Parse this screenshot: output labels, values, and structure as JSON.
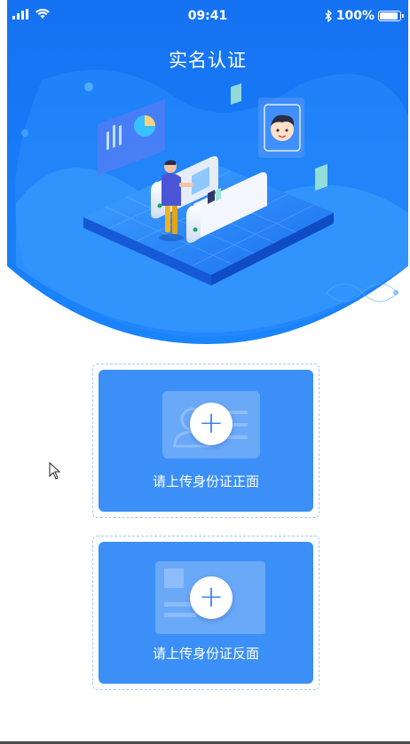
{
  "status_bar": {
    "time": "09:41",
    "battery": "100%",
    "battery_level": 1.0
  },
  "header": {
    "title": "实名认证"
  },
  "uploads": {
    "front_label": "请上传身份证正面",
    "back_label": "请上传身份证反面"
  },
  "colors": {
    "hero_blue": "#1a6ef0",
    "card_blue": "#3b8ff7",
    "card_border": "#a9c6ee"
  },
  "icons": {
    "signal": "signal-icon",
    "wifi": "wifi-icon",
    "bluetooth": "bluetooth-icon",
    "battery": "battery-icon",
    "add_front": "plus-icon",
    "add_back": "plus-icon"
  }
}
